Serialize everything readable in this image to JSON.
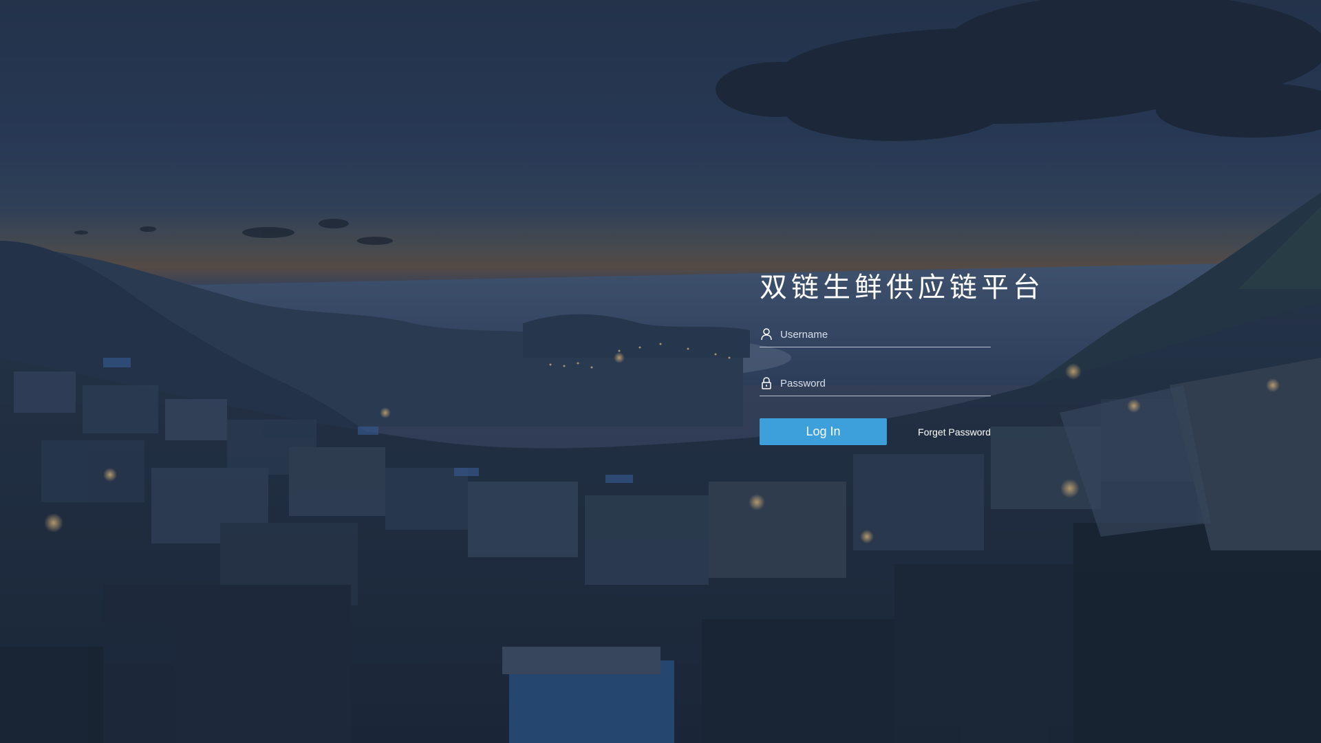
{
  "app": {
    "title": "双链生鲜供应链平台"
  },
  "form": {
    "username_placeholder": "Username",
    "password_placeholder": "Password",
    "username_value": "",
    "password_value": "",
    "login_label": "Log In",
    "forget_label": "Forget Password"
  },
  "icons": {
    "username": "user-icon",
    "password": "lock-icon"
  },
  "colors": {
    "accent": "#3ea0db",
    "text": "#ffffff",
    "underline": "#e6ecf5"
  }
}
